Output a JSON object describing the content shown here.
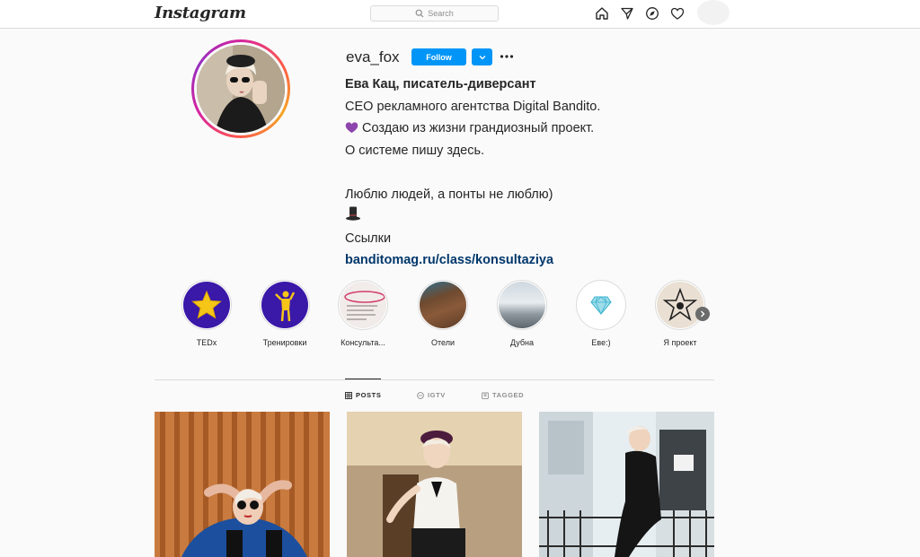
{
  "app": {
    "logo": "Instagram"
  },
  "search": {
    "placeholder": "Search"
  },
  "nav_icons": [
    "home-icon",
    "direct-message-icon",
    "explore-compass-icon",
    "activity-heart-icon"
  ],
  "profile": {
    "username": "eva_fox",
    "follow_label": "Follow",
    "full_name": "Ева Кац, писатель-диверсант",
    "bio_lines": [
      "CEO рекламного агентства Digital Bandito.",
      "Создаю из жизни грандиозный проект.",
      "О системе пишу здесь.",
      "",
      "Люблю людей, а понты не люблю)",
      "",
      "Ссылки"
    ],
    "link": "banditomag.ru/class/konsultaziya"
  },
  "highlights": [
    {
      "label": "TEDx"
    },
    {
      "label": "Тренировки"
    },
    {
      "label": "Консульта..."
    },
    {
      "label": "Отели"
    },
    {
      "label": "Дубна"
    },
    {
      "label": "Еве:)"
    },
    {
      "label": "Я проект"
    }
  ],
  "tabs": [
    {
      "label": "POSTS",
      "icon": "grid-icon",
      "active": true
    },
    {
      "label": "IGTV",
      "icon": "igtv-icon",
      "active": false
    },
    {
      "label": "TAGGED",
      "icon": "tagged-icon",
      "active": false
    }
  ],
  "colors": {
    "accent": "#0095f6",
    "link": "#00376b",
    "text": "#262626",
    "muted": "#8e8e8e"
  }
}
